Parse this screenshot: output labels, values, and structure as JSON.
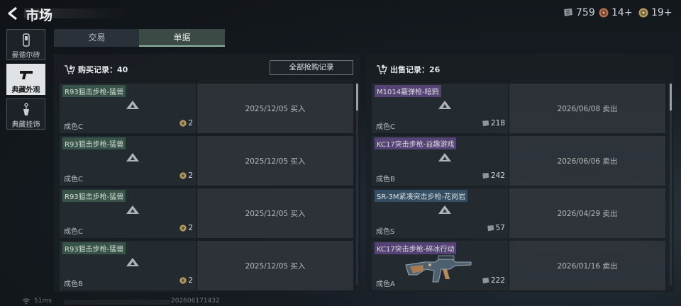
{
  "header": {
    "title": "市场"
  },
  "currencies": [
    {
      "icon": "ticket-icon",
      "value": "759"
    },
    {
      "icon": "bronze-coin-icon",
      "value": "14+"
    },
    {
      "icon": "gold-coin-icon",
      "value": "19+"
    }
  ],
  "sidebar": {
    "items": [
      {
        "label": "曼德尔砖",
        "icon": "mandel-brick-icon",
        "active": false
      },
      {
        "label": "典藏外观",
        "icon": "pistol-icon",
        "active": true
      },
      {
        "label": "典藏挂饰",
        "icon": "charm-icon",
        "active": false
      }
    ]
  },
  "tabs": [
    {
      "label": "交易",
      "active": false
    },
    {
      "label": "单据",
      "active": true
    }
  ],
  "buy_panel": {
    "title": "购买记录：40",
    "all_button": "全部抢购记录",
    "rows": [
      {
        "name": "R93狙击步枪-猛兽",
        "quality": "成色C",
        "price": "2",
        "price_icon": "bronze-coin-icon",
        "date": "2025/12/05 买入"
      },
      {
        "name": "R93狙击步枪-猛兽",
        "quality": "成色C",
        "price": "2",
        "price_icon": "bronze-coin-icon",
        "date": "2025/12/05 买入"
      },
      {
        "name": "R93狙击步枪-猛兽",
        "quality": "成色C",
        "price": "2",
        "price_icon": "bronze-coin-icon",
        "date": "2025/12/05 买入"
      },
      {
        "name": "R93狙击步枪-猛兽",
        "quality": "成色B",
        "price": "2",
        "price_icon": "bronze-coin-icon",
        "date": "2025/12/05 买入"
      }
    ]
  },
  "sell_panel": {
    "title": "出售记录：26",
    "rows": [
      {
        "name": "M1014霰弹枪-暗鸦",
        "quality": "成色C",
        "price": "218",
        "price_icon": "ticket-icon",
        "date": "2026/06/08 卖出"
      },
      {
        "name": "KC17突击步枪-益趣游戏",
        "quality": "成色B",
        "price": "242",
        "price_icon": "ticket-icon",
        "date": "2026/06/06 卖出"
      },
      {
        "name": "SR-3M紧凑突击步枪-花岗岩",
        "quality": "成色S",
        "price": "57",
        "price_icon": "ticket-icon",
        "date": "2026/04/29 卖出"
      },
      {
        "name": "KC17突击步枪-碎冰行动",
        "quality": "成色A",
        "price": "222",
        "price_icon": "ticket-icon",
        "date": "2026/01/16 卖出"
      }
    ]
  },
  "footer": {
    "ping": "51ms",
    "uid": "202606171432"
  }
}
